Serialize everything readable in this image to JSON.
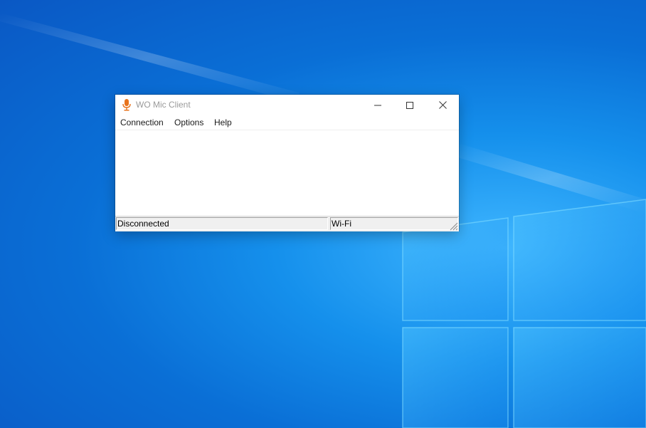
{
  "window": {
    "title": "WO Mic Client",
    "icon": "microphone-icon",
    "accent_color": "#e8731c"
  },
  "titlebar_buttons": {
    "minimize_icon": "minimize-icon",
    "maximize_icon": "maximize-icon",
    "close_icon": "close-icon"
  },
  "menubar": {
    "items": [
      {
        "label": "Connection"
      },
      {
        "label": "Options"
      },
      {
        "label": "Help"
      }
    ]
  },
  "statusbar": {
    "connection_status": "Disconnected",
    "network_type": "Wi-Fi",
    "grip_icon": "resize-grip-icon"
  },
  "desktop": {
    "background_color": "#0a78d9"
  }
}
